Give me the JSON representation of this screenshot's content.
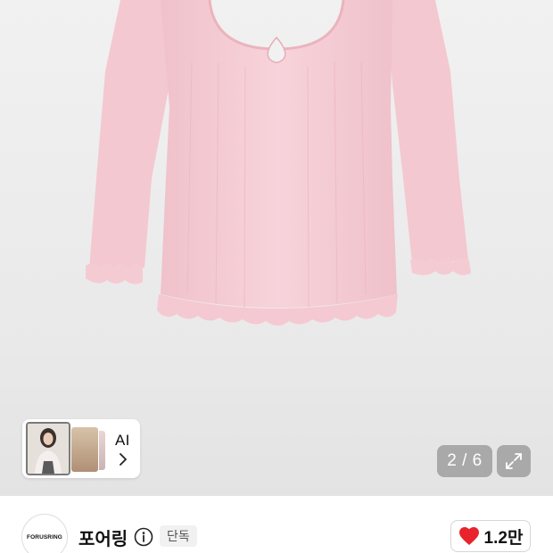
{
  "gallery": {
    "counter_text": "2 / 6",
    "ai_label": "AI"
  },
  "brand": {
    "logo_text": "FORUSRING",
    "name": "포어링",
    "badge": "단독",
    "like_count": "1.2만"
  },
  "icons": {
    "expand": "expand-arrows-icon",
    "info": "info-circle-icon",
    "like": "heart-icon",
    "chevron": "chevron-right-icon"
  },
  "colors": {
    "garment_pink": "#f7cfd7",
    "heart_red": "#e8232b",
    "overlay_gray": "#8a8a8a"
  }
}
